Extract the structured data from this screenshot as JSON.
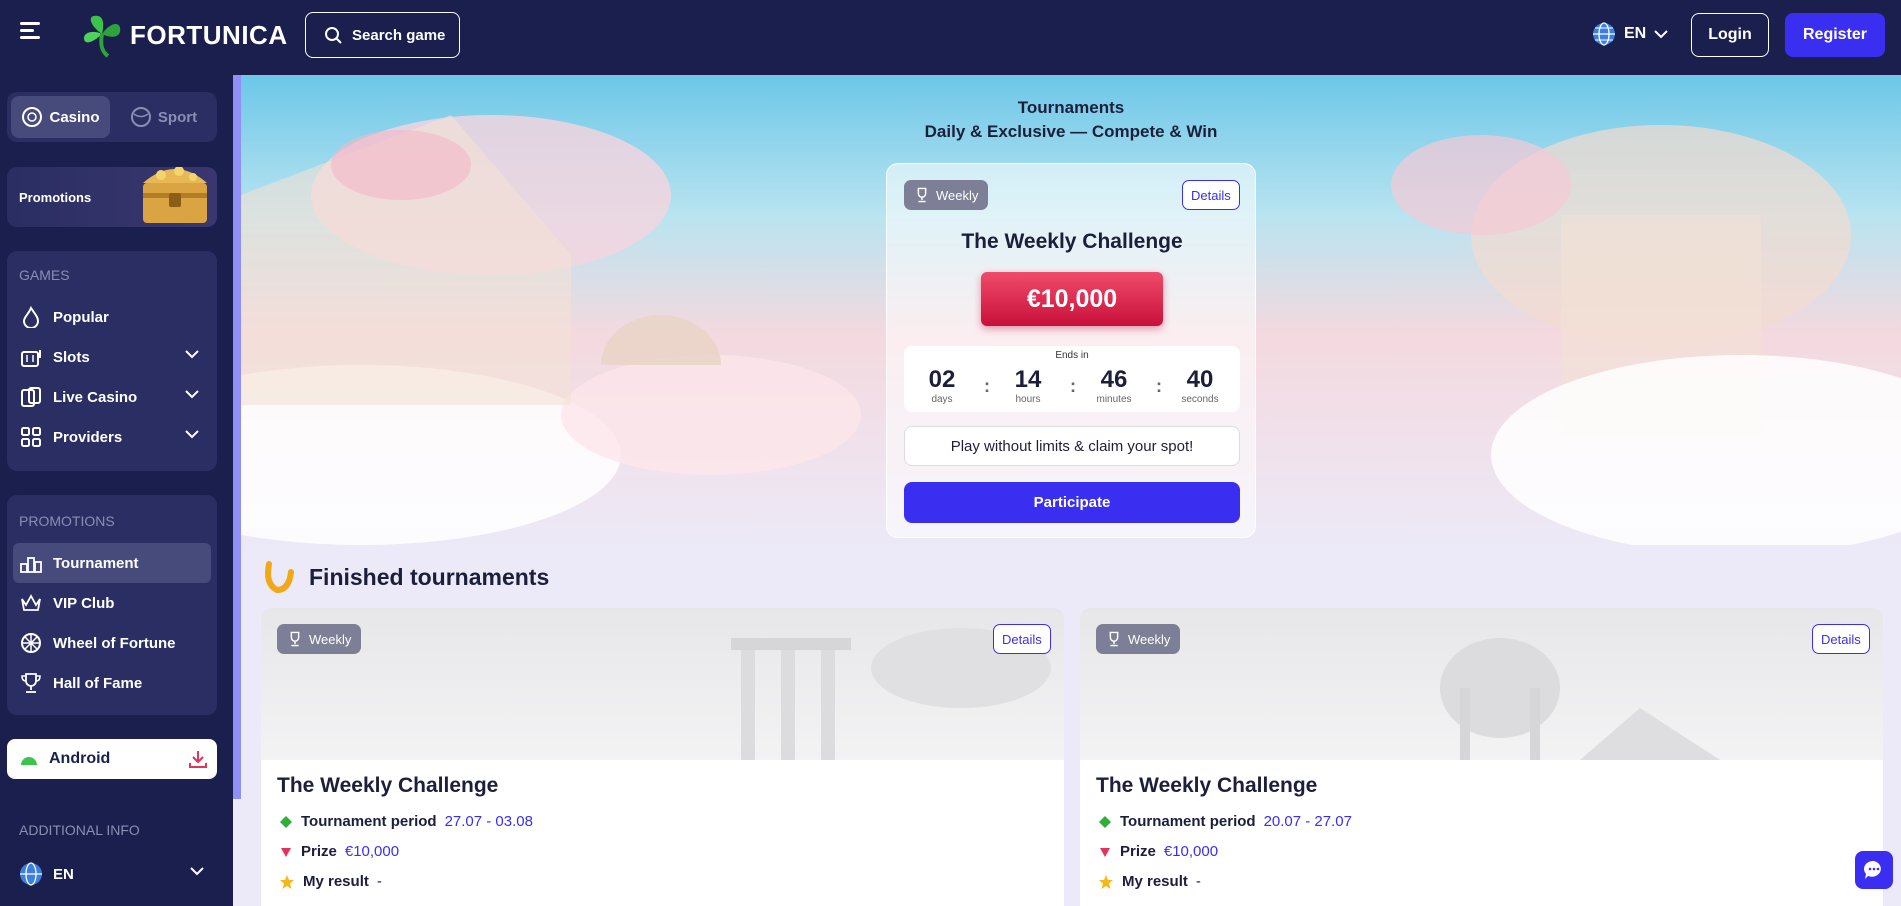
{
  "header": {
    "logo_text": "FORTUNICA",
    "search_label": "Search game",
    "language": "EN",
    "login_label": "Login",
    "register_label": "Register",
    "accent_color": "#3a2ff0"
  },
  "sidebar": {
    "tabs": [
      {
        "label": "Casino",
        "icon": "casino-chip-icon",
        "active": true
      },
      {
        "label": "Sport",
        "icon": "ball-icon",
        "active": false
      }
    ],
    "promo_banner_label": "Promotions",
    "games_title": "GAMES",
    "games": [
      {
        "label": "Popular",
        "icon": "flame-icon"
      },
      {
        "label": "Slots",
        "icon": "slot-machine-icon"
      },
      {
        "label": "Live Casino",
        "icon": "cards-icon"
      },
      {
        "label": "Providers",
        "icon": "grid-icon"
      }
    ],
    "promotions_title": "PROMOTIONS",
    "promotions": [
      {
        "label": "Tournament",
        "icon": "podium-icon",
        "active": true
      },
      {
        "label": "VIP Club",
        "icon": "crown-icon"
      },
      {
        "label": "Wheel of Fortune",
        "icon": "wheel-icon"
      },
      {
        "label": "Hall of Fame",
        "icon": "trophy-icon"
      }
    ],
    "android_label": "Android",
    "additional_title": "ADDITIONAL INFO",
    "language": "EN"
  },
  "hero": {
    "title": "Tournaments",
    "subtitle": "Daily & Exclusive — Compete & Win"
  },
  "current_tournament": {
    "badge": "Weekly",
    "details_label": "Details",
    "title": "The Weekly Challenge",
    "prize": "€10,000",
    "ends_in_label": "Ends in",
    "timer": [
      {
        "value": "02",
        "unit": "days"
      },
      {
        "value": "14",
        "unit": "hours"
      },
      {
        "value": "46",
        "unit": "minutes"
      },
      {
        "value": "40",
        "unit": "seconds"
      }
    ],
    "claim_text": "Play without limits & claim your spot!",
    "participate_label": "Participate"
  },
  "finished": {
    "title": "Finished tournaments",
    "cards": [
      {
        "badge": "Weekly",
        "details_label": "Details",
        "title": "The Weekly Challenge",
        "period_label": "Tournament period",
        "period_value": "27.07 - 03.08",
        "prize_label": "Prize",
        "prize_value": "€10,000",
        "result_label": "My result",
        "result_value": "-"
      },
      {
        "badge": "Weekly",
        "details_label": "Details",
        "title": "The Weekly Challenge",
        "period_label": "Tournament period",
        "period_value": "20.07 - 27.07",
        "prize_label": "Prize",
        "prize_value": "€10,000",
        "result_label": "My result",
        "result_value": "-"
      }
    ]
  }
}
